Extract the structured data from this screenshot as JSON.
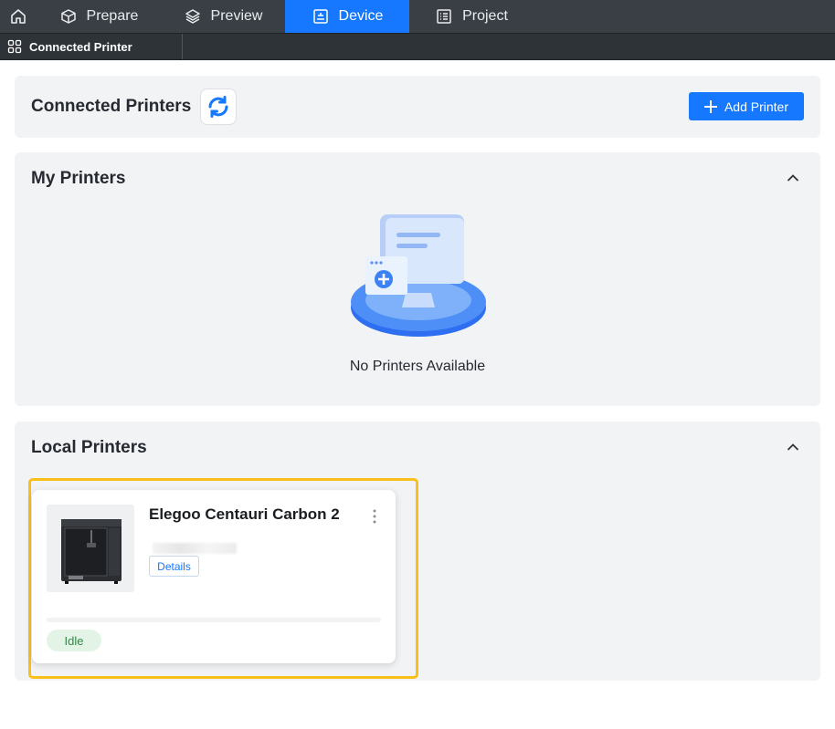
{
  "nav": {
    "home_icon": "home-icon",
    "tabs": [
      {
        "label": "Prepare",
        "icon": "cube-icon"
      },
      {
        "label": "Preview",
        "icon": "layers-icon"
      },
      {
        "label": "Device",
        "icon": "device-icon",
        "active": true
      },
      {
        "label": "Project",
        "icon": "list-icon"
      }
    ],
    "active_color": "#1677ff"
  },
  "subbar": {
    "tab_label": "Connected Printer",
    "icon": "grid-icon"
  },
  "connected": {
    "title": "Connected Printers",
    "refresh_icon": "refresh-icon",
    "add_label": "Add Printer"
  },
  "my_printers": {
    "title": "My Printers",
    "empty_text": "No Printers Available"
  },
  "local_printers": {
    "title": "Local Printers",
    "cards": [
      {
        "name": "Elegoo Centauri Carbon 2",
        "details_label": "Details",
        "status": "Idle",
        "progress": 0
      }
    ]
  },
  "colors": {
    "accent": "#1677ff",
    "highlight": "#fbbf1a",
    "status_idle": "#2e8b47"
  }
}
